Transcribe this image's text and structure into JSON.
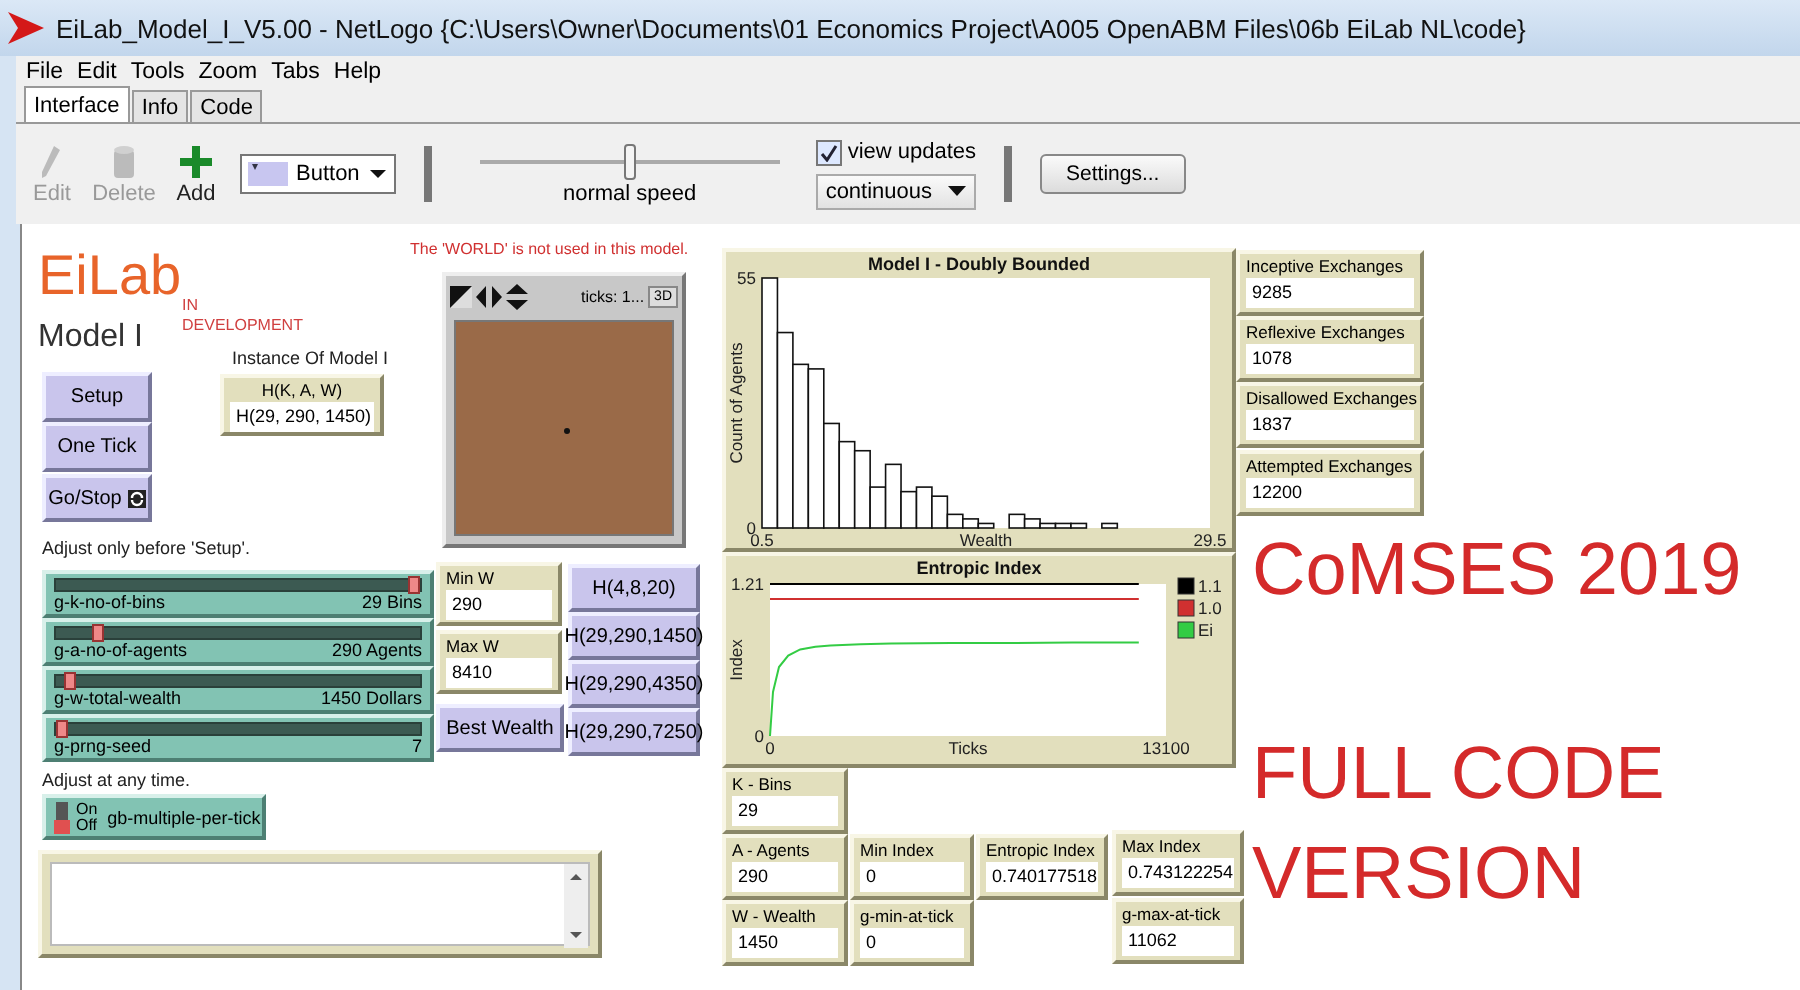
{
  "window": {
    "title": "EiLab_Model_I_V5.00 - NetLogo {C:\\Users\\Owner\\Documents\\01 Economics Project\\A005 OpenABM Files\\06b EiLab NL\\code}"
  },
  "menu": [
    "File",
    "Edit",
    "Tools",
    "Zoom",
    "Tabs",
    "Help"
  ],
  "tabs": [
    {
      "label": "Interface",
      "selected": true
    },
    {
      "label": "Info",
      "selected": false
    },
    {
      "label": "Code",
      "selected": false
    }
  ],
  "toolbar": {
    "tools": [
      {
        "label": "Edit",
        "kind": "edit",
        "disabled": true
      },
      {
        "label": "Delete",
        "kind": "delete",
        "disabled": true
      },
      {
        "label": "Add",
        "kind": "add",
        "disabled": false
      }
    ],
    "widget_type": "Button",
    "speed": {
      "label": "normal speed",
      "level": 0.5
    },
    "view_updates": {
      "label": "view updates",
      "checked": true
    },
    "update_mode": "continuous",
    "settings": "Settings..."
  },
  "interface": {
    "notes": [
      {
        "kind": "logo",
        "text": "EiLab",
        "color": "#e8642a"
      },
      {
        "kind": "tag",
        "text": "IN DEVELOPMENT",
        "color": "#d04040"
      },
      {
        "kind": "heading",
        "text": "Model I",
        "color": "#333333"
      },
      {
        "kind": "label",
        "text": "The 'WORLD' is not used in this model.",
        "color": "#d03030"
      },
      {
        "kind": "label",
        "text": "Instance Of Model I",
        "color": "#222222"
      },
      {
        "kind": "label",
        "text": "Adjust only before 'Setup'.",
        "color": "#222222"
      },
      {
        "kind": "label",
        "text": "Adjust at any time.",
        "color": "#222222"
      },
      {
        "kind": "banner",
        "text": "CoMSES 2019",
        "color": "#d42a2a"
      },
      {
        "kind": "banner",
        "text": "FULL CODE VERSION",
        "color": "#d42a2a"
      }
    ],
    "buttons": [
      {
        "label": "Setup",
        "forever": false
      },
      {
        "label": "One Tick",
        "forever": false
      },
      {
        "label": "Go/Stop",
        "forever": true
      },
      {
        "label": "Best Wealth",
        "forever": false
      },
      {
        "label": "H(4,8,20)",
        "forever": false
      },
      {
        "label": "H(29,290,1450)",
        "forever": false
      },
      {
        "label": "H(29,290,4350)",
        "forever": false
      },
      {
        "label": "H(29,290,7250)",
        "forever": false
      }
    ],
    "monitors": [
      {
        "label": "H(K, A, W)",
        "value": "H(29, 290, 1450)"
      },
      {
        "label": "Min W",
        "value": "290"
      },
      {
        "label": "Max W",
        "value": "8410"
      },
      {
        "label": "Inceptive Exchanges",
        "value": "9285"
      },
      {
        "label": "Reflexive Exchanges",
        "value": "1078"
      },
      {
        "label": "Disallowed Exchanges",
        "value": "1837"
      },
      {
        "label": "Attempted Exchanges",
        "value": "12200"
      },
      {
        "label": "K - Bins",
        "value": "29"
      },
      {
        "label": "A - Agents",
        "value": "290"
      },
      {
        "label": "Min Index",
        "value": "0"
      },
      {
        "label": "Entropic Index",
        "value": "0.740177518"
      },
      {
        "label": "Max Index",
        "value": "0.743122254"
      },
      {
        "label": "W - Wealth",
        "value": "1450"
      },
      {
        "label": "g-min-at-tick",
        "value": "0"
      },
      {
        "label": "g-max-at-tick",
        "value": "11062"
      }
    ],
    "sliders": [
      {
        "name": "g-k-no-of-bins",
        "value": "29 Bins",
        "level": 1
      },
      {
        "name": "g-a-no-of-agents",
        "value": "290 Agents",
        "level": 0.1
      },
      {
        "name": "g-w-total-wealth",
        "value": "1450 Dollars",
        "level": 0.02
      },
      {
        "name": "g-prng-seed",
        "value": "7",
        "level": 0
      }
    ],
    "switch": {
      "label": "gb-multiple-per-tick",
      "on_text": "On",
      "off_text": "Off",
      "on": false
    },
    "view": {
      "ticks": "ticks: 1...",
      "button": "3D"
    },
    "plots": [
      {
        "chart_data": {
          "type": "bar",
          "title": "Model I - Doubly Bounded",
          "xlabel": "Wealth",
          "ylabel": "Count of Agents",
          "x": [
            1,
            2,
            3,
            4,
            5,
            6,
            7,
            8,
            9,
            10,
            11,
            12,
            13,
            14,
            15,
            16,
            17,
            18,
            19,
            20,
            21,
            22,
            23,
            24,
            25,
            26,
            27,
            28,
            29
          ],
          "values": [
            55,
            43,
            36,
            35,
            23,
            19,
            17,
            9,
            14,
            8,
            9,
            7,
            3,
            2,
            1,
            0,
            3,
            2,
            1,
            1,
            1,
            0,
            1,
            0,
            0,
            0,
            0,
            0,
            0
          ],
          "xlim": [
            0.5,
            29.5
          ],
          "ylim": [
            0,
            55
          ],
          "xticks": [
            0.5,
            29.5
          ],
          "yticks": [
            0,
            55
          ]
        }
      },
      {
        "chart_data": {
          "type": "line",
          "title": "Entropic Index",
          "xlabel": "Ticks",
          "ylabel": "Index",
          "x": [
            0,
            100,
            300,
            600,
            1000,
            1500,
            2000,
            3000,
            4000,
            6000,
            8000,
            10000,
            12200
          ],
          "series": [
            {
              "name": "1.1",
              "color": "#000000",
              "values": [
                1.21,
                1.21,
                1.21,
                1.21,
                1.21,
                1.21,
                1.21,
                1.21,
                1.21,
                1.21,
                1.21,
                1.21,
                1.21
              ]
            },
            {
              "name": "1.0",
              "color": "#d03030",
              "values": [
                1.09,
                1.09,
                1.09,
                1.09,
                1.09,
                1.09,
                1.09,
                1.09,
                1.09,
                1.09,
                1.09,
                1.09,
                1.09
              ]
            },
            {
              "name": "Ei",
              "color": "#33cc44",
              "values": [
                0,
                0.35,
                0.55,
                0.64,
                0.69,
                0.71,
                0.72,
                0.73,
                0.735,
                0.74,
                0.74,
                0.745,
                0.745
              ]
            }
          ],
          "legend": "right",
          "xlim": [
            0,
            13100
          ],
          "ylim": [
            0,
            1.21
          ],
          "xticks": [
            0,
            13100
          ],
          "yticks": [
            0,
            1.21
          ]
        }
      }
    ]
  }
}
